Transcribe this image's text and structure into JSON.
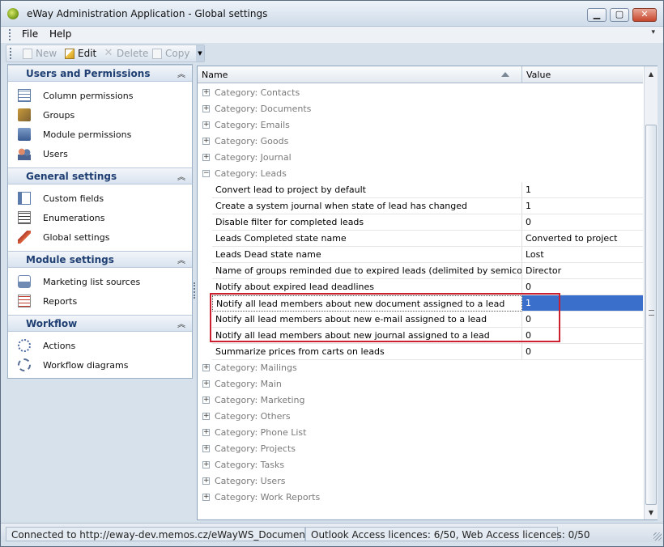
{
  "window": {
    "title": "eWay Administration Application - Global settings",
    "min_label": "▁",
    "max_label": "▢",
    "close_label": "✕"
  },
  "menu": {
    "items": [
      {
        "label": "File"
      },
      {
        "label": "Help"
      }
    ]
  },
  "toolbar": {
    "new_label": "New",
    "edit_label": "Edit",
    "delete_label": "Delete",
    "copy_label": "Copy"
  },
  "sidebar": {
    "sections": [
      {
        "title": "Users and Permissions",
        "items": [
          {
            "label": "Column permissions",
            "icon": "column-permissions-icon"
          },
          {
            "label": "Groups",
            "icon": "groups-icon"
          },
          {
            "label": "Module permissions",
            "icon": "module-permissions-icon"
          },
          {
            "label": "Users",
            "icon": "users-icon"
          }
        ]
      },
      {
        "title": "General settings",
        "items": [
          {
            "label": "Custom fields",
            "icon": "custom-fields-icon"
          },
          {
            "label": "Enumerations",
            "icon": "enumerations-icon"
          },
          {
            "label": "Global settings",
            "icon": "wrench-icon"
          }
        ]
      },
      {
        "title": "Module settings",
        "items": [
          {
            "label": "Marketing list sources",
            "icon": "marketing-list-icon"
          },
          {
            "label": "Reports",
            "icon": "reports-icon"
          }
        ]
      },
      {
        "title": "Workflow",
        "items": [
          {
            "label": "Actions",
            "icon": "gear-icon"
          },
          {
            "label": "Workflow diagrams",
            "icon": "workflow-icon"
          }
        ]
      }
    ]
  },
  "grid": {
    "columns": {
      "name": "Name",
      "value": "Value"
    },
    "rows": [
      {
        "type": "category",
        "label": "Category: Contacts",
        "expander": "+"
      },
      {
        "type": "category",
        "label": "Category: Documents",
        "expander": "+"
      },
      {
        "type": "category",
        "label": "Category: Emails",
        "expander": "+"
      },
      {
        "type": "category",
        "label": "Category: Goods",
        "expander": "+"
      },
      {
        "type": "category",
        "label": "Category: Journal",
        "expander": "+"
      },
      {
        "type": "category",
        "label": "Category: Leads",
        "expander": "−"
      },
      {
        "type": "property",
        "name": "Convert lead to project by default",
        "value": "1"
      },
      {
        "type": "property",
        "name": "Create a system journal when state of lead has changed",
        "value": "1"
      },
      {
        "type": "property",
        "name": "Disable filter for completed leads",
        "value": "0"
      },
      {
        "type": "property",
        "name": "Leads Completed state name",
        "value": "Converted to project"
      },
      {
        "type": "property",
        "name": "Leads Dead state name",
        "value": "Lost"
      },
      {
        "type": "property",
        "name": "Name of groups reminded due to expired leads (delimited by semicolon)",
        "value": "Director"
      },
      {
        "type": "property",
        "name": "Notify about expired lead deadlines",
        "value": "0"
      },
      {
        "type": "property",
        "name": "Notify all lead members about new document assigned to a lead",
        "value": "1",
        "selected": true
      },
      {
        "type": "property",
        "name": "Notify all lead members about new e-mail assigned to a lead",
        "value": "0"
      },
      {
        "type": "property",
        "name": "Notify all lead members about new journal assigned to a lead",
        "value": "0"
      },
      {
        "type": "property",
        "name": "Summarize prices from carts on leads",
        "value": "0"
      },
      {
        "type": "category",
        "label": "Category: Mailings",
        "expander": "+"
      },
      {
        "type": "category",
        "label": "Category: Main",
        "expander": "+"
      },
      {
        "type": "category",
        "label": "Category: Marketing",
        "expander": "+"
      },
      {
        "type": "category",
        "label": "Category: Others",
        "expander": "+"
      },
      {
        "type": "category",
        "label": "Category: Phone List",
        "expander": "+"
      },
      {
        "type": "category",
        "label": "Category: Projects",
        "expander": "+"
      },
      {
        "type": "category",
        "label": "Category: Tasks",
        "expander": "+"
      },
      {
        "type": "category",
        "label": "Category: Users",
        "expander": "+"
      },
      {
        "type": "category",
        "label": "Category: Work Reports",
        "expander": "+"
      }
    ]
  },
  "status": {
    "connection": "Connected to http://eway-dev.memos.cz/eWayWS_Documentation",
    "licences": "Outlook Access licences: 6/50, Web Access licences: 0/50"
  },
  "colors": {
    "selection": "#3a6fcb",
    "highlight_box": "#cc1f2f",
    "section_title": "#1f3f73"
  }
}
